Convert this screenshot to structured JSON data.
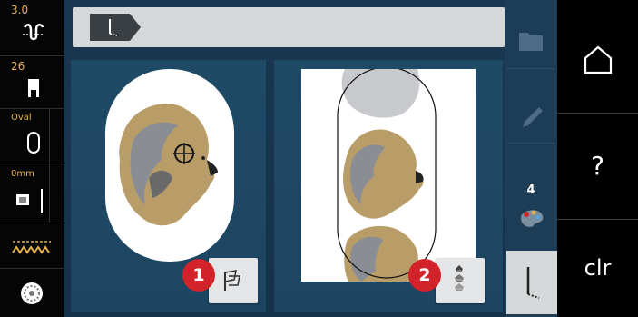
{
  "status_column": {
    "stitch_width": "3.0",
    "needle_position": "26",
    "hoop": "Oval",
    "feed": "0mm"
  },
  "callouts": [
    "1",
    "2"
  ],
  "side_strip": {
    "color_count": "4"
  },
  "nav": {
    "home_label": "home",
    "help_label": "?",
    "clear_label": "clr"
  }
}
